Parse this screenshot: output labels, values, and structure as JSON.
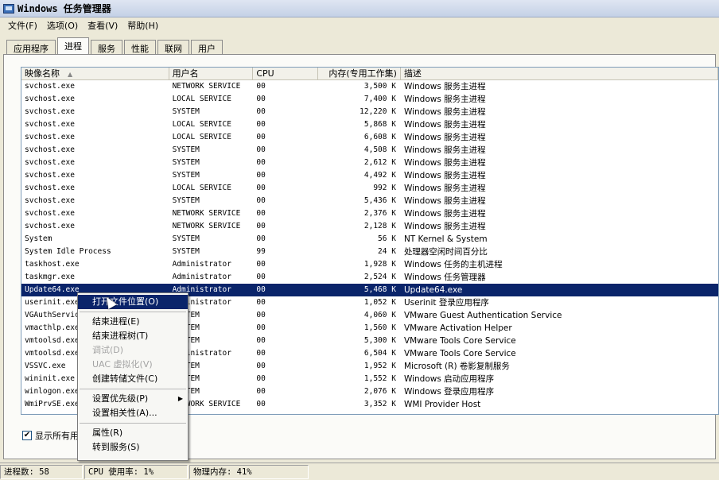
{
  "window": {
    "title": "Windows 任务管理器"
  },
  "menu": [
    "文件(F)",
    "选项(O)",
    "查看(V)",
    "帮助(H)"
  ],
  "tabs": [
    "应用程序",
    "进程",
    "服务",
    "性能",
    "联网",
    "用户"
  ],
  "columns": {
    "name": "映像名称",
    "user": "用户名",
    "cpu": "CPU",
    "mem": "内存(专用工作集)",
    "desc": "描述"
  },
  "rows": [
    {
      "name": "svchost.exe",
      "user": "NETWORK SERVICE",
      "cpu": "00",
      "mem": "3,500 K",
      "desc": "Windows 服务主进程"
    },
    {
      "name": "svchost.exe",
      "user": "LOCAL SERVICE",
      "cpu": "00",
      "mem": "7,400 K",
      "desc": "Windows 服务主进程"
    },
    {
      "name": "svchost.exe",
      "user": "SYSTEM",
      "cpu": "00",
      "mem": "12,220 K",
      "desc": "Windows 服务主进程"
    },
    {
      "name": "svchost.exe",
      "user": "LOCAL SERVICE",
      "cpu": "00",
      "mem": "5,868 K",
      "desc": "Windows 服务主进程"
    },
    {
      "name": "svchost.exe",
      "user": "LOCAL SERVICE",
      "cpu": "00",
      "mem": "6,608 K",
      "desc": "Windows 服务主进程"
    },
    {
      "name": "svchost.exe",
      "user": "SYSTEM",
      "cpu": "00",
      "mem": "4,508 K",
      "desc": "Windows 服务主进程"
    },
    {
      "name": "svchost.exe",
      "user": "SYSTEM",
      "cpu": "00",
      "mem": "2,612 K",
      "desc": "Windows 服务主进程"
    },
    {
      "name": "svchost.exe",
      "user": "SYSTEM",
      "cpu": "00",
      "mem": "4,492 K",
      "desc": "Windows 服务主进程"
    },
    {
      "name": "svchost.exe",
      "user": "LOCAL SERVICE",
      "cpu": "00",
      "mem": "992 K",
      "desc": "Windows 服务主进程"
    },
    {
      "name": "svchost.exe",
      "user": "SYSTEM",
      "cpu": "00",
      "mem": "5,436 K",
      "desc": "Windows 服务主进程"
    },
    {
      "name": "svchost.exe",
      "user": "NETWORK SERVICE",
      "cpu": "00",
      "mem": "2,376 K",
      "desc": "Windows 服务主进程"
    },
    {
      "name": "svchost.exe",
      "user": "NETWORK SERVICE",
      "cpu": "00",
      "mem": "2,128 K",
      "desc": "Windows 服务主进程"
    },
    {
      "name": "System",
      "user": "SYSTEM",
      "cpu": "00",
      "mem": "56 K",
      "desc": "NT Kernel & System"
    },
    {
      "name": "System Idle Process",
      "user": "SYSTEM",
      "cpu": "99",
      "mem": "24 K",
      "desc": "处理器空闲时间百分比"
    },
    {
      "name": "taskhost.exe",
      "user": "Administrator",
      "cpu": "00",
      "mem": "1,928 K",
      "desc": "Windows 任务的主机进程"
    },
    {
      "name": "taskmgr.exe",
      "user": "Administrator",
      "cpu": "00",
      "mem": "2,524 K",
      "desc": "Windows 任务管理器"
    },
    {
      "name": "Update64.exe",
      "user": "Administrator",
      "cpu": "00",
      "mem": "5,468 K",
      "desc": "Update64.exe",
      "selected": true
    },
    {
      "name": "userinit.exe",
      "user": "Administrator",
      "cpu": "00",
      "mem": "1,052 K",
      "desc": "Userinit 登录应用程序"
    },
    {
      "name": "VGAuthService.exe",
      "user": "SYSTEM",
      "cpu": "00",
      "mem": "4,060 K",
      "desc": "VMware Guest Authentication Service"
    },
    {
      "name": "vmacthlp.exe",
      "user": "SYSTEM",
      "cpu": "00",
      "mem": "1,560 K",
      "desc": "VMware Activation Helper"
    },
    {
      "name": "vmtoolsd.exe",
      "user": "SYSTEM",
      "cpu": "00",
      "mem": "5,300 K",
      "desc": "VMware Tools Core Service"
    },
    {
      "name": "vmtoolsd.exe",
      "user": "Administrator",
      "cpu": "00",
      "mem": "6,504 K",
      "desc": "VMware Tools Core Service"
    },
    {
      "name": "VSSVC.exe",
      "user": "SYSTEM",
      "cpu": "00",
      "mem": "1,952 K",
      "desc": "Microsoft (R) 卷影复制服务"
    },
    {
      "name": "wininit.exe",
      "user": "SYSTEM",
      "cpu": "00",
      "mem": "1,552 K",
      "desc": "Windows 启动应用程序"
    },
    {
      "name": "winlogon.exe",
      "user": "SYSTEM",
      "cpu": "00",
      "mem": "2,076 K",
      "desc": "Windows 登录应用程序"
    },
    {
      "name": "WmiPrvSE.exe",
      "user": "NETWORK SERVICE",
      "cpu": "00",
      "mem": "3,352 K",
      "desc": "WMI Provider Host"
    }
  ],
  "show_all_label": "显示所有用户的进程",
  "status": {
    "processes": "进程数: 58",
    "cpu": "CPU 使用率: 1%",
    "memory": "物理内存: 41%"
  },
  "context_menu": [
    {
      "label": "打开文件位置(O)",
      "highlighted": true
    },
    {
      "sep": true
    },
    {
      "label": "结束进程(E)"
    },
    {
      "label": "结束进程树(T)"
    },
    {
      "label": "调试(D)",
      "disabled": true
    },
    {
      "label": "UAC 虚拟化(V)",
      "disabled": true
    },
    {
      "label": "创建转储文件(C)"
    },
    {
      "sep": true
    },
    {
      "label": "设置优先级(P)",
      "submenu": true
    },
    {
      "label": "设置相关性(A)..."
    },
    {
      "sep": true
    },
    {
      "label": "属性(R)"
    },
    {
      "label": "转到服务(S)"
    }
  ]
}
